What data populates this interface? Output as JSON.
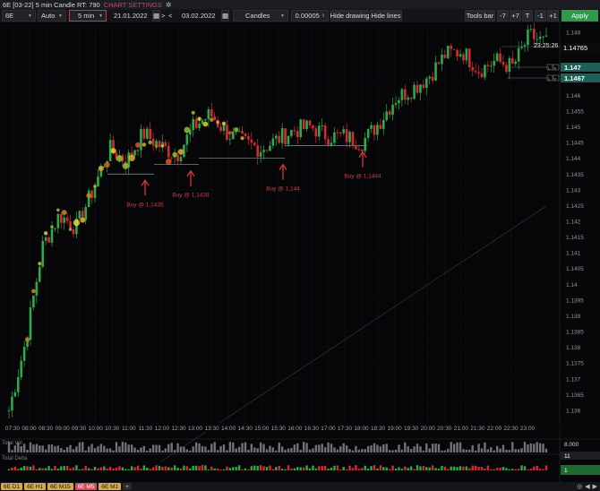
{
  "window": {
    "title": "6E [03-22] 5 min Candle RT: 790",
    "chart_settings": "CHART SETTINGS"
  },
  "toolbar": {
    "symbol": "6E",
    "mode": "Auto",
    "interval": "5 min",
    "date_from": "21.01.2022",
    "date_to": "03.02.2022",
    "chart_type": "Candles",
    "tick_size": "0.00005",
    "hide_drawing": "Hide drawing",
    "hide_lines": "Hide lines",
    "tools_bar": "Tools bar",
    "minus7": "-7",
    "plus7": "+7",
    "t": "T",
    "minus1": "-1",
    "plus1": "+1",
    "apply": "Apply",
    "nav_next": ">",
    "nav_prev": "<"
  },
  "price_axis": {
    "labels": [
      "1.148",
      "1.1475",
      "1.1465",
      "1.146",
      "1.1455",
      "1.145",
      "1.1445",
      "1.144",
      "1.1435",
      "1.143",
      "1.1425",
      "1.142",
      "1.1415",
      "1.141",
      "1.1405",
      "1.14",
      "1.1395",
      "1.139",
      "1.1385",
      "1.138",
      "1.1375",
      "1.137",
      "1.1365",
      "1.136"
    ],
    "current_price": "1.14765",
    "timer": "23:25:26",
    "level_1": "1.147",
    "level_2": "1.1467",
    "volume_label": "8.000",
    "delta_value": "11",
    "delta_value_2": "1"
  },
  "time_axis": {
    "labels": [
      "07:30",
      "08:00",
      "08:30",
      "09:00",
      "09:30",
      "10:00",
      "10:30",
      "11:00",
      "11:30",
      "12:00",
      "12:30",
      "13:00",
      "13:30",
      "14:00",
      "14:30",
      "15:00",
      "15:30",
      "16:00",
      "16:30",
      "17:00",
      "17:30",
      "18:00",
      "18:30",
      "19:00",
      "19:30",
      "20:00",
      "20:30",
      "21:00",
      "21:30",
      "22:00",
      "22:30",
      "23:00"
    ]
  },
  "annotations": [
    {
      "text": "Buy @ 1,1435"
    },
    {
      "text": "Buy @ 1,1438"
    },
    {
      "text": "Buy @ 1,144"
    },
    {
      "text": "Buy @ 1,1444"
    }
  ],
  "panels": {
    "total_volume": "Total Vol",
    "total_delta": "Total Delta"
  },
  "tabs": [
    {
      "label": "6E D1"
    },
    {
      "label": "6E H1"
    },
    {
      "label": "6E M15"
    },
    {
      "label": "6E M5",
      "active": true
    },
    {
      "label": "6E M1"
    },
    {
      "label": "+"
    }
  ],
  "colors": {
    "up": "#2fa84a",
    "down": "#d32b35",
    "accent": "#d23a3a",
    "current": "#1f5f55"
  },
  "chart_data": {
    "type": "candlestick",
    "x": [
      "07:30",
      "08:00",
      "08:30",
      "09:00",
      "09:30",
      "10:00",
      "10:30",
      "11:00",
      "11:30",
      "12:00",
      "12:30",
      "13:00",
      "13:30",
      "14:00",
      "14:30",
      "15:00",
      "15:30",
      "16:00",
      "16:30",
      "17:00",
      "17:30",
      "18:00",
      "18:30",
      "19:00",
      "19:30",
      "20:00",
      "20:30",
      "21:00",
      "21:30",
      "22:00",
      "22:30",
      "23:00",
      "23:25"
    ],
    "close": [
      1.136,
      1.1382,
      1.1412,
      1.1422,
      1.1418,
      1.143,
      1.1443,
      1.1439,
      1.1448,
      1.1444,
      1.1441,
      1.145,
      1.1454,
      1.1448,
      1.1445,
      1.1443,
      1.1446,
      1.1449,
      1.145,
      1.1447,
      1.1447,
      1.1445,
      1.1451,
      1.1459,
      1.1462,
      1.1466,
      1.1473,
      1.1474,
      1.1468,
      1.1471,
      1.1469,
      1.1479,
      1.14765
    ],
    "ylim": [
      1.1358,
      1.1482
    ],
    "buy_levels": [
      1.1435,
      1.1438,
      1.144,
      1.1444
    ],
    "current": 1.14765
  }
}
